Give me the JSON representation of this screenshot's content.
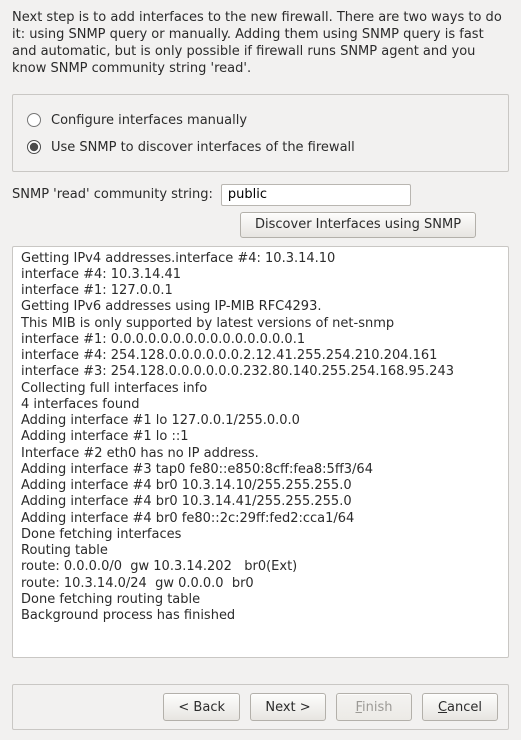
{
  "intro": "Next step is to add interfaces to the new firewall. There are two ways to do it: using SNMP query or manually. Adding them using SNMP query is fast and automatic, but is only possible if firewall runs SNMP agent and you know SNMP community string 'read'.",
  "options": {
    "manual": "Configure interfaces manually",
    "snmp": "Use SNMP to discover interfaces of the firewall"
  },
  "selected_option": "snmp",
  "snmp": {
    "label": "SNMP 'read' community string:",
    "value": "public",
    "discover_button": "Discover Interfaces using SNMP"
  },
  "log_lines": [
    "Getting IPv4 addresses.interface #4: 10.3.14.10",
    "interface #4: 10.3.14.41",
    "interface #1: 127.0.0.1",
    "Getting IPv6 addresses using IP-MIB RFC4293.",
    "This MIB is only supported by latest versions of net-snmp",
    "interface #1: 0.0.0.0.0.0.0.0.0.0.0.0.0.0.0.1",
    "interface #4: 254.128.0.0.0.0.0.0.2.12.41.255.254.210.204.161",
    "interface #3: 254.128.0.0.0.0.0.0.232.80.140.255.254.168.95.243",
    "Collecting full interfaces info",
    "4 interfaces found",
    "Adding interface #1 lo 127.0.0.1/255.0.0.0",
    "Adding interface #1 lo ::1",
    "Interface #2 eth0 has no IP address.",
    "Adding interface #3 tap0 fe80::e850:8cff:fea8:5ff3/64",
    "Adding interface #4 br0 10.3.14.10/255.255.255.0",
    "Adding interface #4 br0 10.3.14.41/255.255.255.0",
    "Adding interface #4 br0 fe80::2c:29ff:fed2:cca1/64",
    "Done fetching interfaces",
    "Routing table",
    "route: 0.0.0.0/0  gw 10.3.14.202   br0(Ext)",
    "route: 10.3.14.0/24  gw 0.0.0.0  br0",
    "Done fetching routing table",
    "Background process has finished"
  ],
  "buttons": {
    "back": "< Back",
    "next": "Next >",
    "finish_plain": "Finish",
    "cancel_plain": "Cancel"
  }
}
